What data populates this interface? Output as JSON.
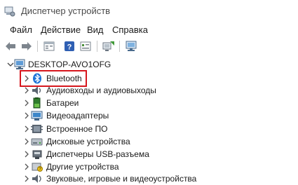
{
  "window": {
    "title": "Диспетчер устройств"
  },
  "menu": [
    "Файл",
    "Действие",
    "Вид",
    "Справка"
  ],
  "toolbar": {
    "buttons": [
      "back-icon",
      "forward-icon",
      "properties-icon",
      "help-icon",
      "view-icon",
      "update-driver-icon",
      "monitor-icon"
    ]
  },
  "tree": {
    "root": "DESKTOP-AVO1OFG",
    "items": [
      {
        "label": "Bluetooth",
        "icon": "bluetooth-icon"
      },
      {
        "label": "Аудиовходы и аудиовыходы",
        "icon": "speaker-icon"
      },
      {
        "label": "Батареи",
        "icon": "battery-icon"
      },
      {
        "label": "Видеоадаптеры",
        "icon": "display-adapter-icon"
      },
      {
        "label": "Встроенное ПО",
        "icon": "firmware-icon"
      },
      {
        "label": "Дисковые устройства",
        "icon": "disk-icon"
      },
      {
        "label": "Диспетчеры USB-разъема",
        "icon": "usb-icon"
      },
      {
        "label": "Другие устройства",
        "icon": "other-devices-icon"
      },
      {
        "label": "Звуковые, игровые и видеоустройства",
        "icon": "sound-icon"
      }
    ]
  },
  "colors": {
    "highlight": "#d6161d",
    "bluetooth": "#1e73d8"
  }
}
